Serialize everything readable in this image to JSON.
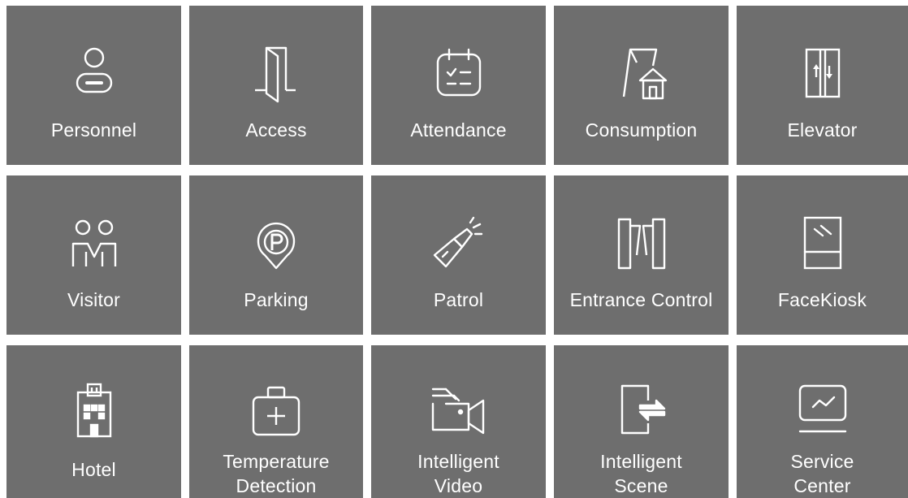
{
  "modules": [
    {
      "label": "Personnel",
      "icon": "person-icon"
    },
    {
      "label": "Access",
      "icon": "door-icon"
    },
    {
      "label": "Attendance",
      "icon": "calendar-check-icon"
    },
    {
      "label": "Consumption",
      "icon": "shop-icon"
    },
    {
      "label": "Elevator",
      "icon": "elevator-icon"
    },
    {
      "label": "Visitor",
      "icon": "visitor-icon"
    },
    {
      "label": "Parking",
      "icon": "parking-icon"
    },
    {
      "label": "Patrol",
      "icon": "flashlight-icon"
    },
    {
      "label": "Entrance Control",
      "icon": "turnstile-icon"
    },
    {
      "label": "FaceKiosk",
      "icon": "kiosk-icon"
    },
    {
      "label": "Hotel",
      "icon": "hotel-icon"
    },
    {
      "label": "Temperature\nDetection",
      "icon": "medical-kit-icon"
    },
    {
      "label": "Intelligent\nVideo",
      "icon": "video-camera-icon"
    },
    {
      "label": "Intelligent\nScene",
      "icon": "scene-switch-icon"
    },
    {
      "label": "Service\nCenter",
      "icon": "monitor-chart-icon"
    }
  ],
  "colors": {
    "tile_bg": "#6e6e6e",
    "tile_fg": "#ffffff",
    "page_bg": "#ffffff"
  }
}
